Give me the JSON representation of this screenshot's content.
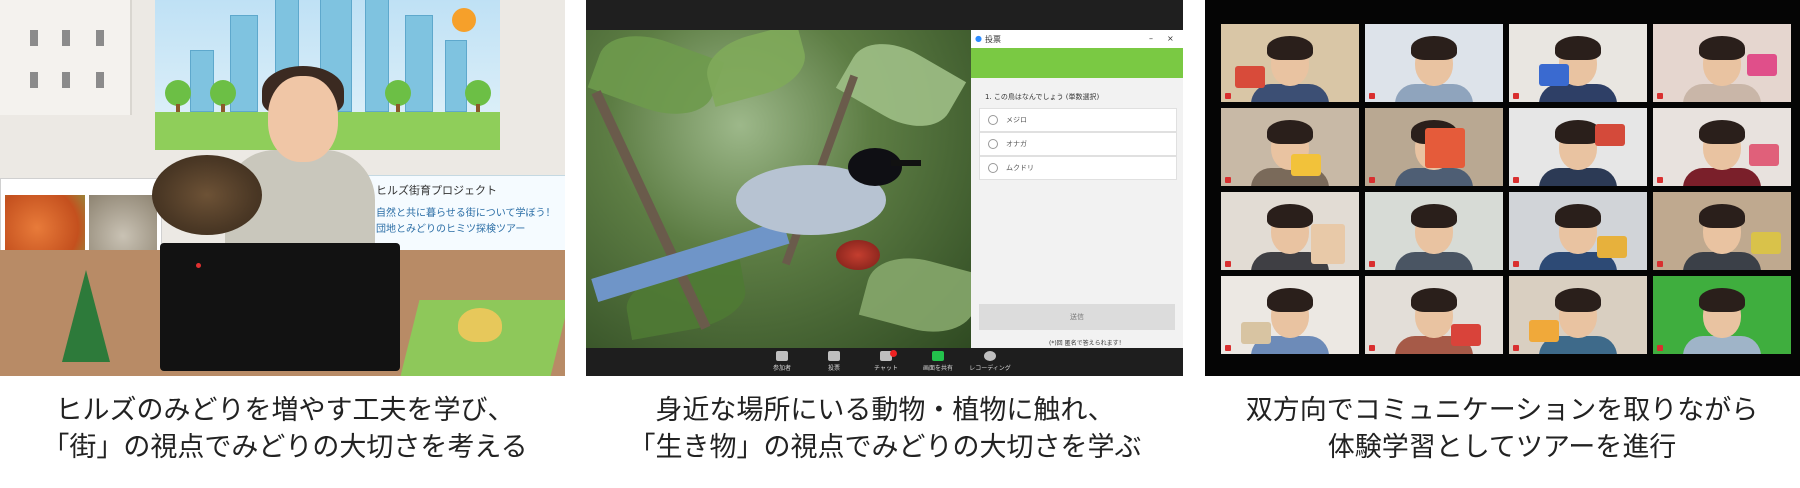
{
  "panels": [
    {
      "name": "hills-guide",
      "caption_lines": [
        "ヒルズのみどりを増やす工夫を学び、",
        "「街」の視点でみどりの大切さを考える"
      ],
      "sign_title": "ヒルズ街育プロジェクト",
      "sign_text_1": "自然と共に暮らせる街について学ぼう！",
      "sign_text_2": "団地とみどりのヒミツ探検ツアー"
    },
    {
      "name": "zoom-bird-poll",
      "caption_lines": [
        "身近な場所にいる動物・植物に触れ、",
        "「生き物」の視点でみどりの大切さを学ぶ"
      ],
      "poll": {
        "title": "投票",
        "question": "1. この鳥はなんでしょう (単数選択)",
        "options": [
          "メジロ",
          "オナガ",
          "ムクドリ"
        ],
        "submit": "送信",
        "footer": "(*)回 匿名で答えられます！"
      },
      "toolbar": [
        "参加者",
        "投票",
        "チャット",
        "画面を共有",
        "レコーディング"
      ]
    },
    {
      "name": "zoom-gallery",
      "caption_lines": [
        "双方向でコミュニケーションを取りながら",
        "体験学習としてツアーを進行"
      ]
    }
  ],
  "colors": {
    "poll_header": "#7ac943",
    "toolbar_bg": "#1e1e1e",
    "share_green": "#23c24c",
    "caption_text": "#222222"
  }
}
